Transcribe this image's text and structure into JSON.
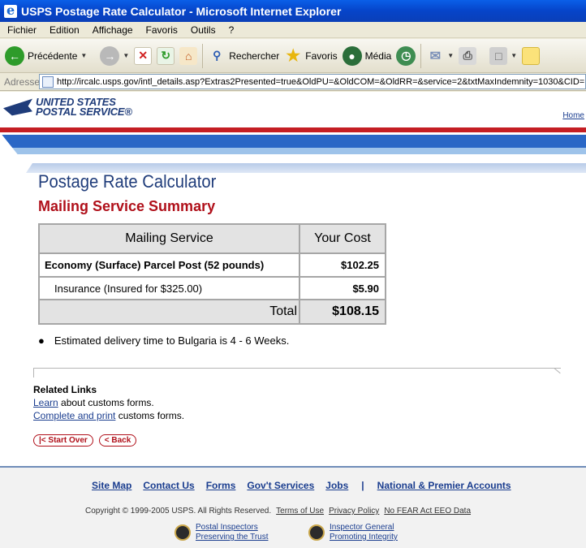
{
  "window": {
    "title": "USPS Postage Rate Calculator - Microsoft Internet Explorer"
  },
  "menu": [
    "Fichier",
    "Edition",
    "Affichage",
    "Favoris",
    "Outils",
    "?"
  ],
  "toolbar": {
    "back": "Précédente",
    "search": "Rechercher",
    "favorites": "Favoris",
    "media": "Média"
  },
  "address": {
    "label": "Adresse",
    "url": "http://ircalc.usps.gov/intl_details.asp?Extras2Presented=true&OldPU=&OldCOM=&OldRR=&service=2&txtMaxIndemnity=1030&CID="
  },
  "header": {
    "logo_line1": "UNITED STATES",
    "logo_line2": "POSTAL SERVICE®",
    "home": "Home"
  },
  "content": {
    "title": "Postage Rate Calculator",
    "subtitle": "Mailing Service Summary",
    "table": {
      "col_service": "Mailing Service",
      "col_cost": "Your Cost",
      "rows": [
        {
          "service": "Economy (Surface) Parcel Post (52 pounds)",
          "cost": "$102.25"
        },
        {
          "service": "Insurance (Insured for $325.00)",
          "cost": "$5.90"
        }
      ],
      "total_label": "Total",
      "total_value": "$108.15"
    },
    "bullet": "Estimated delivery time to Bulgaria is 4 - 6 Weeks.",
    "related_title": "Related Links",
    "learn_link": "Learn",
    "learn_rest": " about customs forms.",
    "complete_link": "Complete and print",
    "complete_rest": " customs forms.",
    "start_over": "|< Start Over",
    "back_btn": "< Back"
  },
  "footer": {
    "links": [
      "Site Map",
      "Contact Us",
      "Forms",
      "Gov't Services",
      "Jobs"
    ],
    "separator": "|",
    "accounts": "National & Premier Accounts",
    "copyright": "Copyright © 1999-2005 USPS. All Rights Reserved.",
    "terms": "Terms of Use",
    "privacy": "Privacy Policy",
    "nofear": "No FEAR Act EEO Data",
    "inspectors1": "Postal Inspectors",
    "inspectors2": "Preserving the Trust",
    "ig1": "Inspector General",
    "ig2": "Promoting Integrity"
  }
}
